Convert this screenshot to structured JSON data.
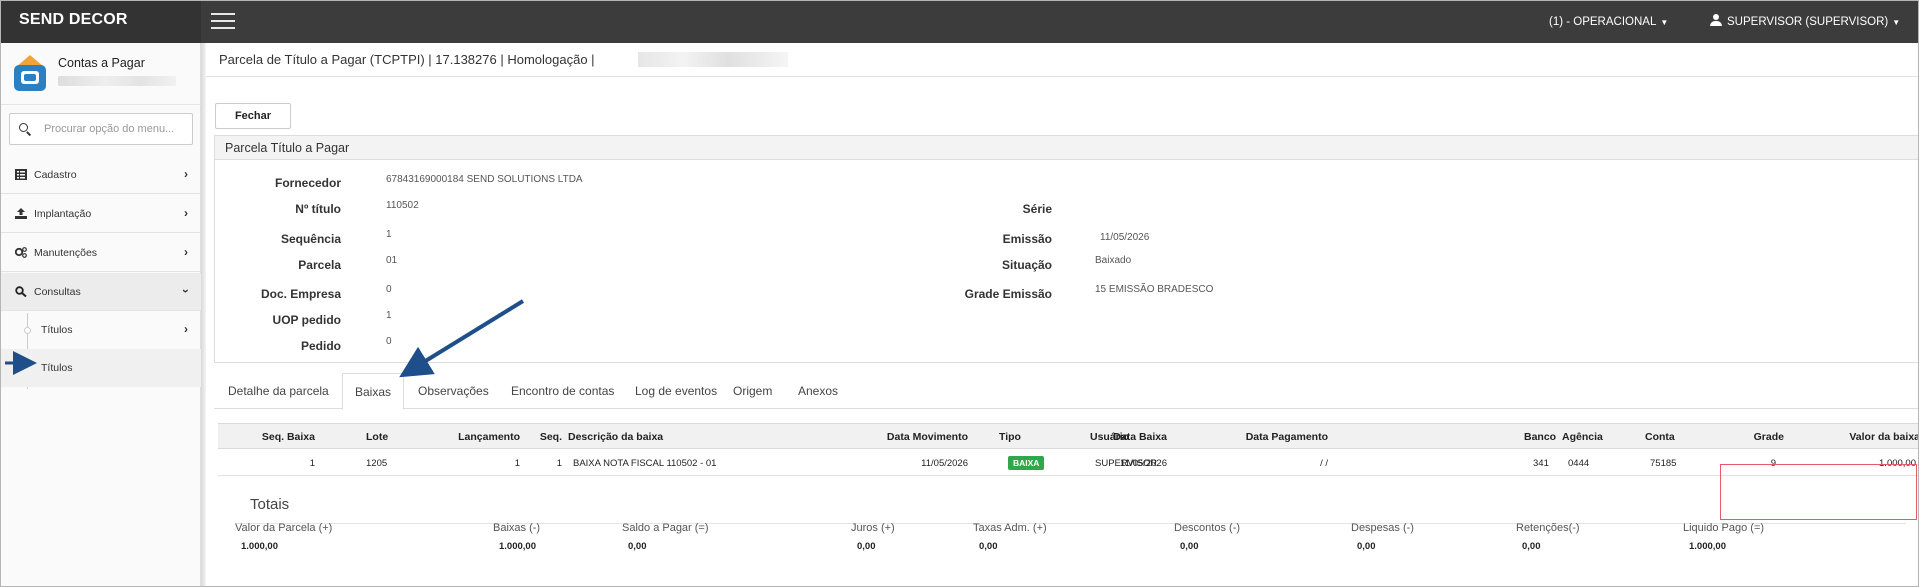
{
  "app": {
    "brand": "SEND DECOR"
  },
  "topbar": {
    "company": "(1) - OPERACIONAL",
    "user": "SUPERVISOR (SUPERVISOR)"
  },
  "sidebar": {
    "module_title": "Contas a Pagar",
    "search_placeholder": "Procurar opção do menu...",
    "items": [
      {
        "label": "Cadastro",
        "icon": "list-icon"
      },
      {
        "label": "Implantação",
        "icon": "upload-icon"
      },
      {
        "label": "Manutenções",
        "icon": "gears-icon"
      },
      {
        "label": "Consultas",
        "icon": "search-icon"
      }
    ],
    "subitems": [
      {
        "label": "Títulos"
      },
      {
        "label": "Títulos"
      }
    ]
  },
  "page": {
    "title": "Parcela de Título a Pagar (TCPTPI) | 17.138276 | Homologação |"
  },
  "toolbar": {
    "close_label": "Fechar"
  },
  "panel": {
    "title": "Parcela Título a Pagar",
    "fields_left": [
      {
        "label": "Fornecedor",
        "value": "67843169000184    SEND SOLUTIONS LTDA"
      },
      {
        "label": "Nº título",
        "value": "110502"
      },
      {
        "label": "Sequência",
        "value": "1"
      },
      {
        "label": "Parcela",
        "value": "01"
      },
      {
        "label": "Doc. Empresa",
        "value": "0"
      },
      {
        "label": "UOP pedido",
        "value": "1"
      },
      {
        "label": "Pedido",
        "value": "0"
      }
    ],
    "fields_right": [
      {
        "label": "Série",
        "value": ""
      },
      {
        "label": "Emissão",
        "value": "11/05/2026"
      },
      {
        "label": "Situação",
        "value": "Baixado"
      },
      {
        "label": "Grade Emissão",
        "value": "15    EMISSÃO BRADESCO"
      }
    ]
  },
  "tabs": [
    {
      "label": "Detalhe da parcela"
    },
    {
      "label": "Baixas",
      "active": true
    },
    {
      "label": "Observações"
    },
    {
      "label": "Encontro de contas"
    },
    {
      "label": "Log de eventos"
    },
    {
      "label": "Origem"
    },
    {
      "label": "Anexos"
    }
  ],
  "grid": {
    "columns": [
      "Seq. Baixa",
      "Lote",
      "Lançamento",
      "Seq.",
      "Descrição da baixa",
      "Data Movimento",
      "Tipo",
      "Usuário",
      "Data Baixa",
      "Data Pagamento",
      "Banco",
      "Agência",
      "Conta",
      "Grade",
      "Valor da baixa"
    ],
    "rows": [
      {
        "seq_baixa": "1",
        "lote": "1205",
        "lancamento": "1",
        "seq": "1",
        "descricao": "BAIXA NOTA FISCAL 110502 - 01",
        "data_movimento": "11/05/2026",
        "tipo": "BAIXA",
        "usuario": "SUPERVISOR",
        "data_baixa": "11/05/2026",
        "data_pagamento": "/ /",
        "banco": "341",
        "agencia": "0444",
        "conta": "75185",
        "grade": "9",
        "valor": "1.000,00"
      }
    ]
  },
  "totais": {
    "title": "Totais",
    "items": [
      {
        "label": "Valor da Parcela (+)",
        "value": "1.000,00"
      },
      {
        "label": "Baixas (-)",
        "value": "1.000,00"
      },
      {
        "label": "Saldo a Pagar (=)",
        "value": "0,00"
      },
      {
        "label": "Juros (+)",
        "value": "0,00"
      },
      {
        "label": "Taxas Adm. (+)",
        "value": "0,00"
      },
      {
        "label": "Descontos (-)",
        "value": "0,00"
      },
      {
        "label": "Despesas (-)",
        "value": "0,00"
      },
      {
        "label": "Retenções(-)",
        "value": "0,00"
      },
      {
        "label": "Liquido Pago (=)",
        "value": "1.000,00"
      }
    ]
  },
  "colors": {
    "topbar": "#3c3c3c",
    "badge": "#2ea84a",
    "highlight": "#e55b6b",
    "arrow": "#1f4f8a"
  }
}
